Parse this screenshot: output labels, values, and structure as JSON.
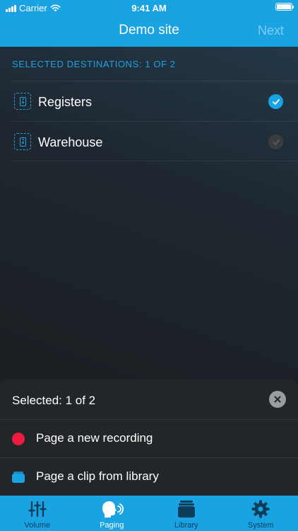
{
  "status_bar": {
    "carrier": "Carrier",
    "time": "9:41 AM"
  },
  "nav": {
    "title": "Demo site",
    "next_label": "Next"
  },
  "destinations": {
    "section_label": "SELECTED DESTINATIONS: 1 OF 2",
    "items": [
      {
        "label": "Registers",
        "icon": "speaker-icon",
        "selected": true
      },
      {
        "label": "Warehouse",
        "icon": "speaker-icon",
        "selected": false
      }
    ]
  },
  "sheet": {
    "title": "Selected: 1 of 2",
    "actions": [
      {
        "label": "Page a new recording",
        "icon": "record-dot-icon"
      },
      {
        "label": "Page a clip from library",
        "icon": "library-icon"
      }
    ]
  },
  "tabs": [
    {
      "label": "Volume",
      "icon": "sliders-icon",
      "active": false
    },
    {
      "label": "Paging",
      "icon": "speaking-head-icon",
      "active": true
    },
    {
      "label": "Library",
      "icon": "library-stack-icon",
      "active": false
    },
    {
      "label": "System",
      "icon": "gear-icon",
      "active": false
    }
  ],
  "colors": {
    "accent": "#1aa3e3",
    "record": "#ee1c3f",
    "background": "#1b1f23",
    "sheet": "#232628"
  }
}
